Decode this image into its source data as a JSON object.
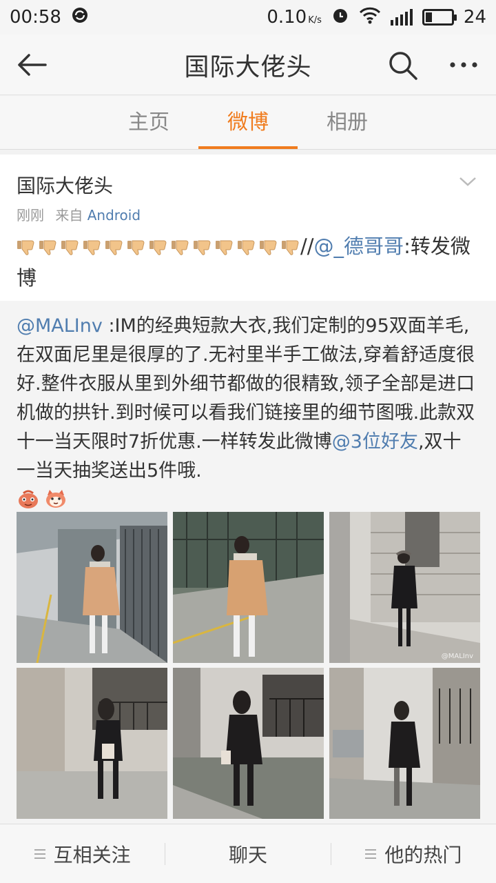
{
  "status_bar": {
    "time": "00:58",
    "net_speed": "0.10",
    "net_unit": "K/s",
    "battery": "24",
    "battery_level": 0.24
  },
  "nav": {
    "title": "国际大佬头"
  },
  "tabs": [
    {
      "label": "主页",
      "active": false
    },
    {
      "label": "微博",
      "active": true
    },
    {
      "label": "相册",
      "active": false
    }
  ],
  "post": {
    "author": "国际大佬头",
    "time": "刚刚",
    "source_prefix": "来自",
    "source": "Android",
    "thumbs_count": 13,
    "text_sep": "//",
    "mention": "@_德哥哥",
    "text_suffix": ":转发微博"
  },
  "retweet": {
    "mention": "@MALInv",
    "text1": " :IM的经典短款大衣,我们定制的95双面羊毛,在双面尼里是很厚的了.无衬里半手工做法,穿着舒适度很好.整件衣服从里到外细节都做的很精致,领子全部是进口机做的拱针.到时候可以看我们链接里的细节图哦.此款双十一当天限时7折优惠.一样转发此微博",
    "inline_link": "@3位好友",
    "text2": ",双十一当天抽奖送出5件哦.",
    "watermark": "@MALInv"
  },
  "bottom_bar": {
    "follow": "互相关注",
    "chat": "聊天",
    "hot": "他的热门"
  },
  "colors": {
    "accent": "#f07c1e",
    "link": "#507daf"
  }
}
